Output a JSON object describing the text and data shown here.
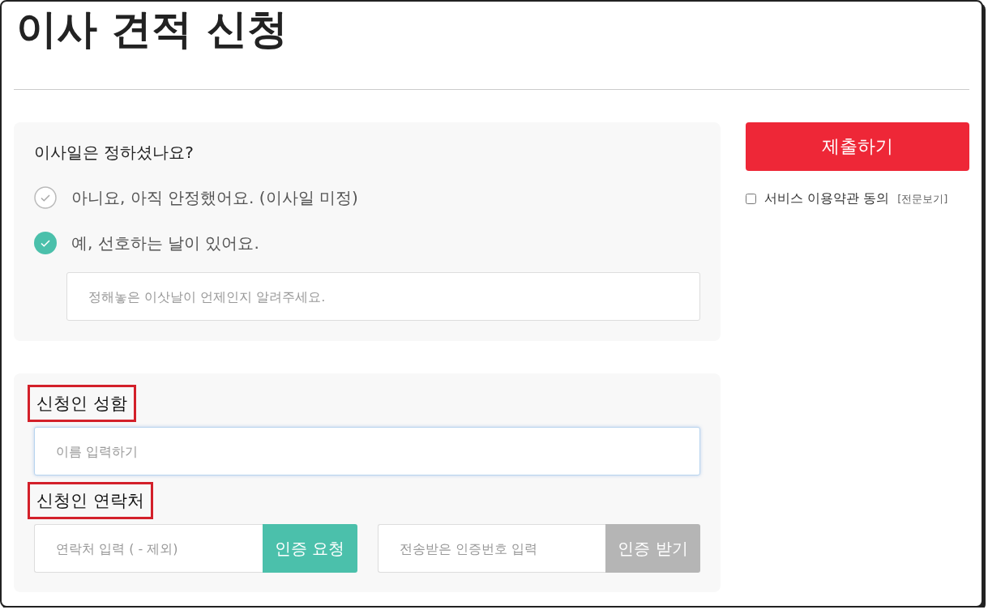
{
  "title": "이사 견적 신청",
  "move_date": {
    "question": "이사일은 정하셨나요?",
    "options": [
      {
        "label": "아니요, 아직 안정했어요. (이사일 미정)",
        "selected": false
      },
      {
        "label": "예, 선호하는 날이 있어요.",
        "selected": true
      }
    ],
    "date_field": {
      "placeholder": "정해놓은 이삿날이 언제인지 알려주세요."
    }
  },
  "applicant": {
    "name_label": {
      "text": "신청인 성함",
      "highlighted": true
    },
    "name_field": {
      "placeholder": "이름 입력하기",
      "focused": true
    },
    "contact_label": {
      "text": "신청인 연락처",
      "highlighted": true
    },
    "verification": [
      {
        "placeholder": "연락처 입력 ( - 제외)",
        "button": "인증 요청",
        "disabled": false
      },
      {
        "placeholder": "전송받은 인증번호 입력",
        "button": "인증 받기",
        "disabled": true
      }
    ]
  },
  "submit_button": "제출하기",
  "terms": {
    "label": "서비스 이용약관 동의",
    "link": "[전문보기]",
    "checked": false
  }
}
